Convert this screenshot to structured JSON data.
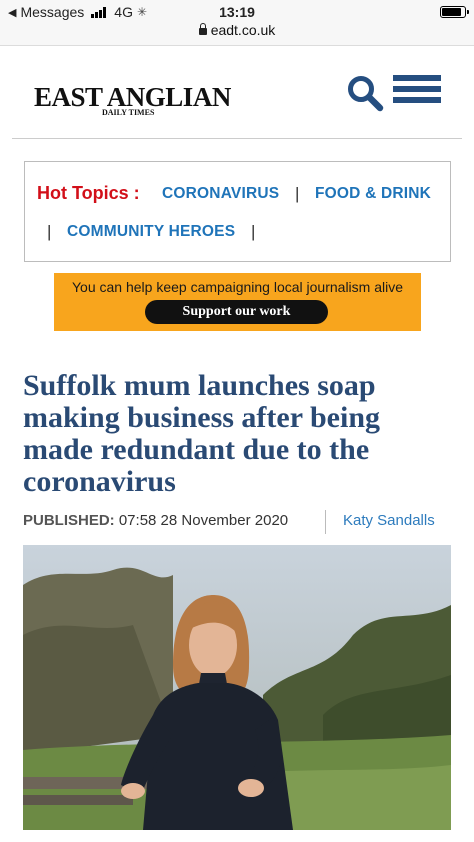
{
  "status_bar": {
    "back_app": "Messages",
    "network": "4G",
    "time": "13:19",
    "battery_level": 0.8
  },
  "url_bar": {
    "domain": "eadt.co.uk",
    "lock_icon": "lock-icon"
  },
  "header": {
    "logo_title": "EAST ANGLIAN",
    "logo_subtitle": "DAILY TIMES",
    "search_icon": "search-icon",
    "menu_icon": "hamburger-menu-icon",
    "brand_color": "#254e80"
  },
  "hot_topics": {
    "label": "Hot Topics :",
    "items": [
      {
        "label": "CORONAVIRUS"
      },
      {
        "label": "FOOD & DRINK"
      },
      {
        "label": "COMMUNITY HEROES"
      }
    ],
    "label_color": "#d20f19",
    "link_color": "#1f74b9"
  },
  "support_banner": {
    "text": "You can help keep campaigning local journalism alive",
    "button": "Support our work",
    "background": "#f8a51d"
  },
  "article": {
    "headline": "Suffolk mum launches soap making business after being made redundant due to the coronavirus",
    "published_label": "PUBLISHED:",
    "published_value": "07:58 28 November 2020",
    "author": "Katy Sandalls",
    "photo_alt": "woman-outdoors-photo"
  }
}
